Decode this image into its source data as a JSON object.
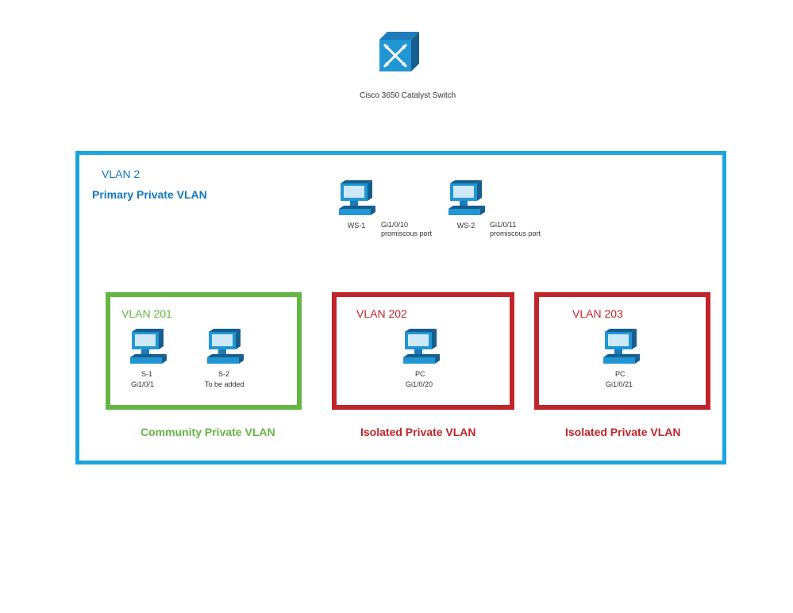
{
  "switch": {
    "label": "Cisco 3650 Catalyst Switch"
  },
  "primary": {
    "vlan": "VLAN 2",
    "title": "Primary Private VLAN"
  },
  "ws1": {
    "name": "WS-1",
    "port": "Gi1/0/10",
    "note": "promiscous port"
  },
  "ws2": {
    "name": "WS-2",
    "port": "Gi1/0/11",
    "note": "promiscous port"
  },
  "community": {
    "vlan": "VLAN 201",
    "label": "Community Private VLAN"
  },
  "s1": {
    "name": "S-1",
    "port": "Gi1/0/1"
  },
  "s2": {
    "name": "S-2",
    "note": "To be added"
  },
  "isolated1": {
    "vlan": "VLAN 202",
    "label": "Isolated Private VLAN"
  },
  "pc1": {
    "name": "PC",
    "port": "Gi1/0/20"
  },
  "isolated2": {
    "vlan": "VLAN 203",
    "label": "Isolated Private VLAN"
  },
  "pc2": {
    "name": "PC",
    "port": "Gi1/0/21"
  },
  "colors": {
    "blue": "#19a6de",
    "darkblue": "#1178c2",
    "green": "#64b643",
    "red": "#c12429",
    "icon": "#1c7bb8"
  }
}
